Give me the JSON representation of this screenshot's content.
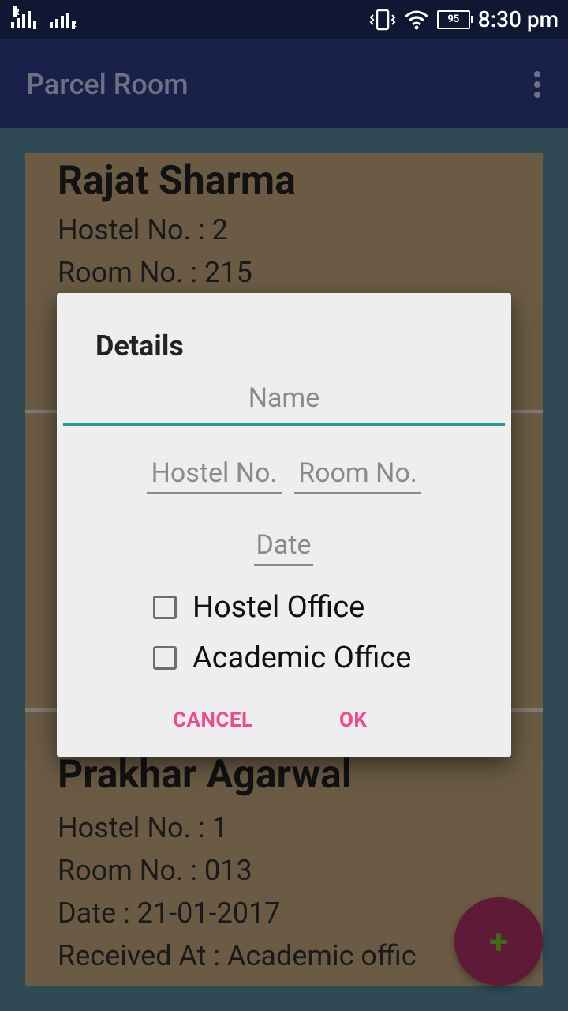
{
  "status": {
    "time": "8:30 pm",
    "battery": "95",
    "sim1": "R",
    "sim1_index": "1",
    "sim2_index": "2"
  },
  "app": {
    "title": "Parcel Room"
  },
  "cards": [
    {
      "name": "Rajat Sharma",
      "hostel": "Hostel No. : 2",
      "room": "Room No. : 215"
    },
    {
      "name": "Prakhar Agarwal",
      "hostel": "Hostel No. : 1",
      "room": "Room No. : 013",
      "date": "Date : 21-01-2017",
      "received": "Received At : Academic offic"
    }
  ],
  "fab": {
    "icon": "plus-icon",
    "glyph": "+"
  },
  "dialog": {
    "title": "Details",
    "name_placeholder": "Name",
    "hostel_placeholder": "Hostel No.",
    "room_placeholder": "Room No.",
    "date_placeholder": "Date",
    "checkbox_hostel_office": "Hostel Office",
    "checkbox_academic_office": "Academic Office",
    "cancel_label": "CANCEL",
    "ok_label": "OK"
  },
  "colors": {
    "appbar": "#19214a",
    "accent_underline": "#1f9d8f",
    "button_text": "#f04a8b",
    "card_bg": "#6b5b45",
    "fab": "#5e1a36"
  }
}
